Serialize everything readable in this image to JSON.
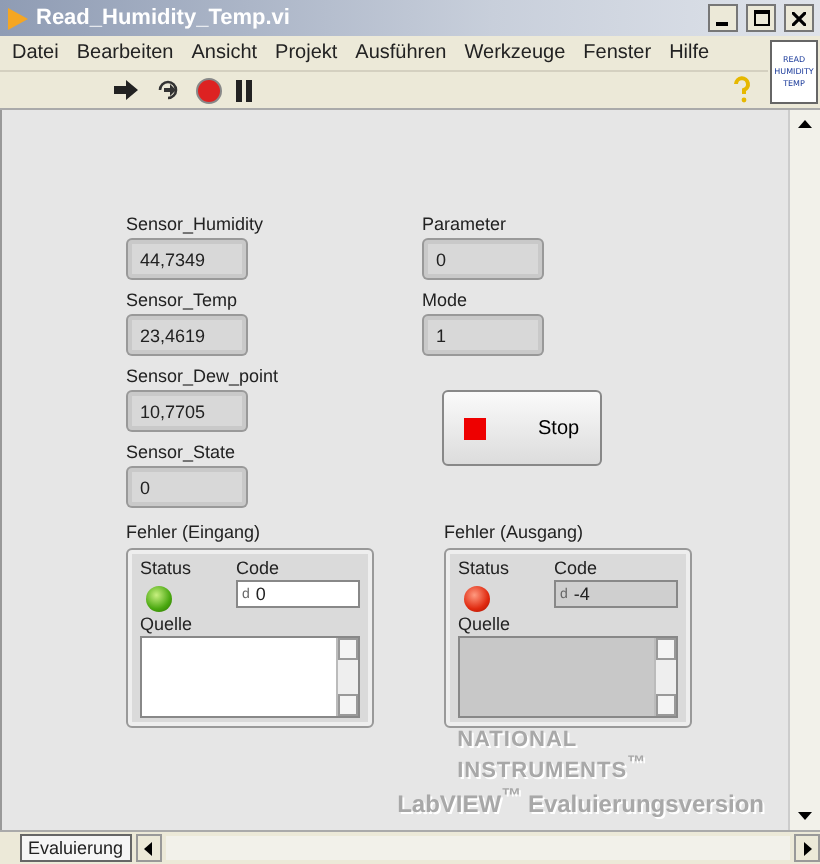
{
  "window": {
    "title": "Read_Humidity_Temp.vi"
  },
  "menu": [
    "Datei",
    "Bearbeiten",
    "Ansicht",
    "Projekt",
    "Ausführen",
    "Werkzeuge",
    "Fenster",
    "Hilfe"
  ],
  "vi_icon": [
    "READ",
    "HUMIDITY",
    "TEMP"
  ],
  "indicators_left": [
    {
      "label": "Sensor_Humidity",
      "value": "44,7349"
    },
    {
      "label": "Sensor_Temp",
      "value": "23,4619"
    },
    {
      "label": "Sensor_Dew_point",
      "value": "10,7705"
    },
    {
      "label": "Sensor_State",
      "value": "0"
    }
  ],
  "indicators_right": [
    {
      "label": "Parameter",
      "value": "0"
    },
    {
      "label": "Mode",
      "value": "1"
    }
  ],
  "stop_button": {
    "label": "Stop"
  },
  "error_clusters": [
    {
      "label": "Fehler (Eingang)",
      "kind": "control",
      "status_label": "Status",
      "status": false,
      "code_label": "Code",
      "code_radix": "d",
      "code": "0",
      "source_label": "Quelle"
    },
    {
      "label": "Fehler (Ausgang)",
      "kind": "indicator",
      "status_label": "Status",
      "status": true,
      "code_label": "Code",
      "code_radix": "d",
      "code": "-4",
      "source_label": "Quelle"
    }
  ],
  "watermark": [
    "NATIONAL",
    "INSTRUMENTS$^{™}$",
    "LabVIEW$^{™}$ Evaluierungsversion"
  ],
  "bottom_tab": "Evaluierung"
}
